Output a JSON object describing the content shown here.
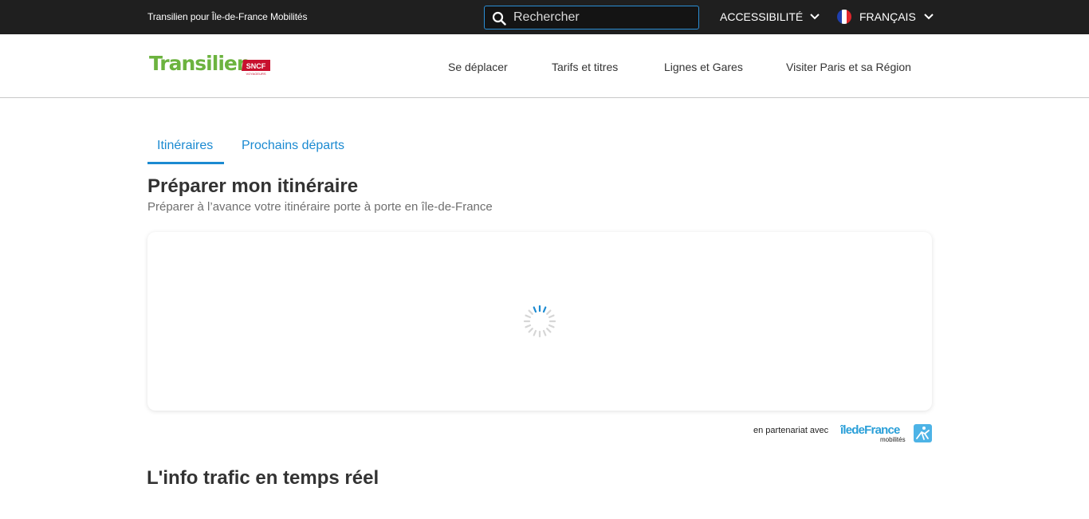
{
  "topbar": {
    "tagline": "Transilien pour Île-de-France Mobilités",
    "search_placeholder": "Rechercher",
    "accessibility_label": "ACCESSIBILITÉ",
    "language_label": "FRANÇAIS"
  },
  "header": {
    "logo_text": "Transilien",
    "logo_badge": "SNCF",
    "logo_badge_sub": "VOYAGEURS",
    "nav": [
      "Se déplacer",
      "Tarifs et titres",
      "Lignes et Gares",
      "Visiter Paris et sa Région"
    ]
  },
  "tabs": [
    {
      "label": "Itinéraires",
      "active": true
    },
    {
      "label": "Prochains départs",
      "active": false
    }
  ],
  "main": {
    "title": "Préparer mon itinéraire",
    "subtitle": "Préparer à l’avance votre itinéraire porte à porte en île-de-France",
    "card_state": "loading"
  },
  "partner": {
    "label": "en partenariat avec",
    "logo_text": "îledeFrance",
    "logo_sub": "mobilités"
  },
  "traffic": {
    "title": "L'info trafic en temps réel"
  },
  "colors": {
    "accent": "#1b8ad1",
    "topbar_bg": "#1f1f1f",
    "brand_green": "#6cb33f",
    "sncf_red": "#c8102e",
    "idf_blue": "#2a9fd8"
  }
}
